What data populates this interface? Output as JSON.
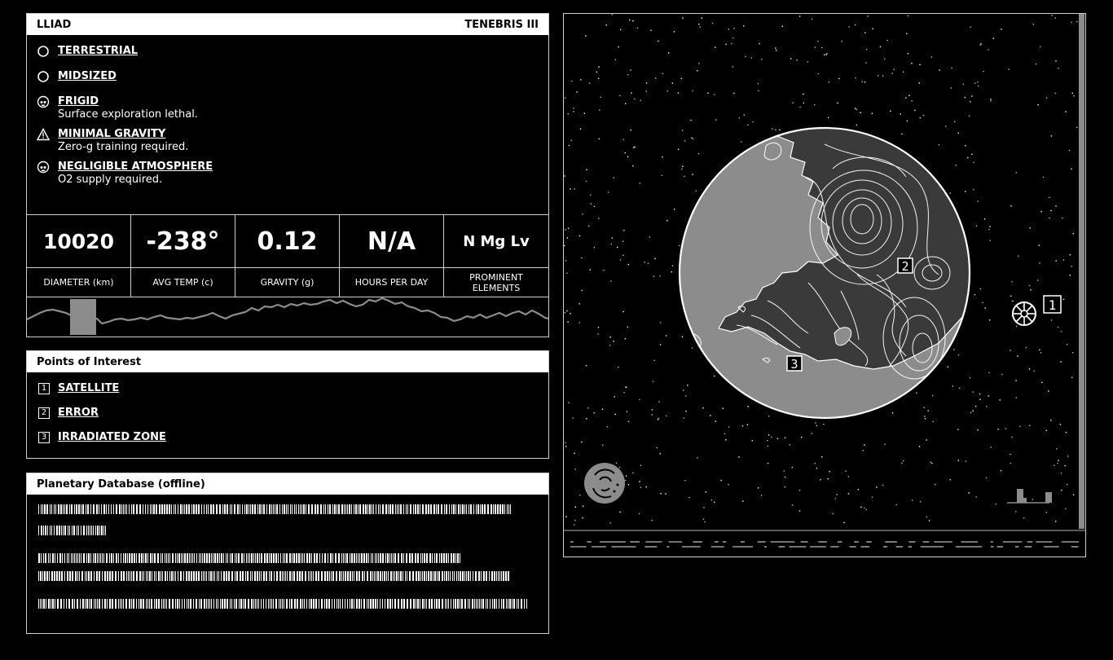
{
  "planet": {
    "system": "LLIAD",
    "name": "TENEBRIS III",
    "traits": [
      {
        "name": "TERRESTRIAL",
        "description": "",
        "icon": "circle-icon"
      },
      {
        "name": "MIDSIZED",
        "description": "",
        "icon": "circle-icon"
      },
      {
        "name": "FRIGID",
        "description": "Surface exploration lethal.",
        "icon": "skull-icon"
      },
      {
        "name": "MINIMAL GRAVITY",
        "description": "Zero-g training required.",
        "icon": "warning-icon"
      },
      {
        "name": "NEGLIGIBLE ATMOSPHERE",
        "description": "O2 supply required.",
        "icon": "skull-icon"
      }
    ],
    "stats": [
      {
        "value": "10020",
        "label": "DIAMETER (km)"
      },
      {
        "value": "-238°",
        "label": "AVG TEMP (c)"
      },
      {
        "value": "0.12",
        "label": "GRAVITY (g)"
      },
      {
        "value": "N/A",
        "label": "HOURS PER DAY"
      },
      {
        "value": "N Mg Lv",
        "label": "PROMINENT ELEMENTS"
      }
    ]
  },
  "poi": {
    "title": "Points of Interest",
    "items": [
      {
        "num": "1",
        "name": "SATELLITE"
      },
      {
        "num": "2",
        "name": "ERROR"
      },
      {
        "num": "3",
        "name": "IRRADIATED ZONE"
      }
    ]
  },
  "database": {
    "title": "Planetary Database (offline)"
  },
  "map": {
    "markers": [
      "1",
      "2",
      "3"
    ],
    "colors": {
      "background": "#000000",
      "land": "#8c8c8c",
      "water": "#3a3a3a",
      "line": "#ffffff"
    }
  }
}
